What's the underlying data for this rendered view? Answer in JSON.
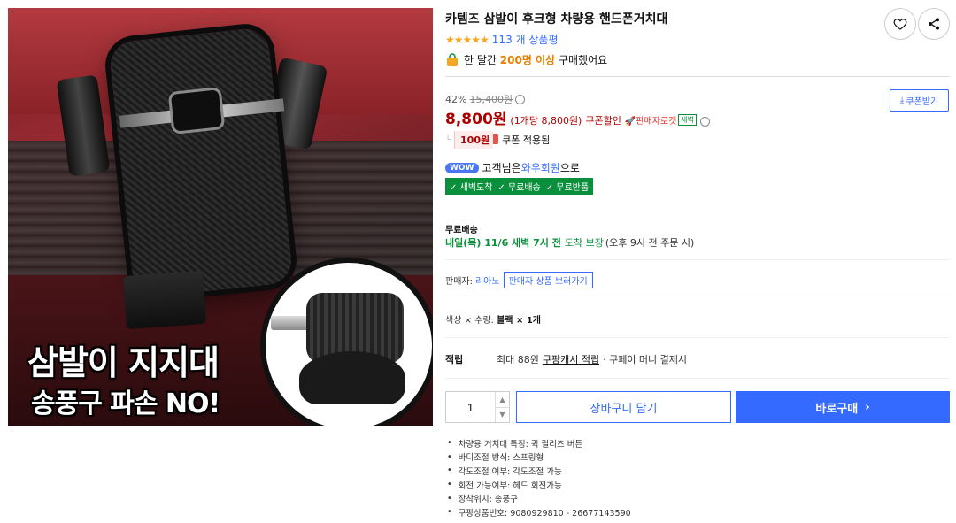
{
  "image": {
    "headline": "삼발이 지지대",
    "subline": "송풍구 파손 NO!"
  },
  "product": {
    "title": "카템즈 삼발이 후크형 차량용 핸드폰거치대",
    "rating_stars": "★★★★★",
    "rating_value": 5,
    "review_count": "113 개 상품평",
    "buy_count_prefix": "한 달간",
    "buy_count_highlight": "200명 이상",
    "buy_count_suffix": "구매했어요"
  },
  "actions": {
    "wishlist_icon": "heart-icon",
    "share_icon": "share-icon"
  },
  "price": {
    "discount_rate": "42%",
    "original": "15,400원",
    "final": "8,800원",
    "unit_price": "(1개당 8,800원)",
    "coupon_label": "쿠폰할인",
    "rocket_label": "🚀판매자로켓",
    "new_badge": "새벽",
    "coupon_download": "쿠폰받기",
    "coupon_amount": "100원",
    "coupon_applied": "쿠폰 적용됨"
  },
  "wow": {
    "badge": "WOW",
    "text_prefix": "고객님은",
    "link": "와우회원",
    "text_suffix": "으로",
    "benefits": [
      "✓ 새벽도착",
      "✓ 무료배송",
      "✓ 무료반품"
    ]
  },
  "shipping": {
    "title": "무료배송",
    "date": "내일(목) 11/6 새벽 7시 전",
    "guarantee": "도착 보장",
    "note": "(오후 9시 전 주문 시)"
  },
  "seller": {
    "label": "판매자:",
    "name": "리아노",
    "button": "판매자 상품 보러가기"
  },
  "option": {
    "label": "색상 × 수량:",
    "value": "블랙 × 1개"
  },
  "points": {
    "label": "적립",
    "prefix": "최대 88원",
    "link": "쿠팡캐시 적립",
    "suffix": "· 쿠페이 머니 결제시"
  },
  "purchase": {
    "quantity": "1",
    "cart_label": "장바구니 담기",
    "buy_label": "바로구매",
    "buy_chevron": "›"
  },
  "attributes": [
    "차량용 거치대 특징: 퀵 릴리즈 버튼",
    "바디조절 방식: 스프링형",
    "각도조절 여부: 각도조절 가능",
    "회전 가능여부: 헤드 회전가능",
    "장착위치: 송풍구",
    "쿠팡상품번호: 9080929810 - 26677143590"
  ],
  "colors": {
    "accent": "#346aff",
    "price": "#ae0000",
    "green": "#0a8f3c",
    "star": "#f5a623"
  }
}
